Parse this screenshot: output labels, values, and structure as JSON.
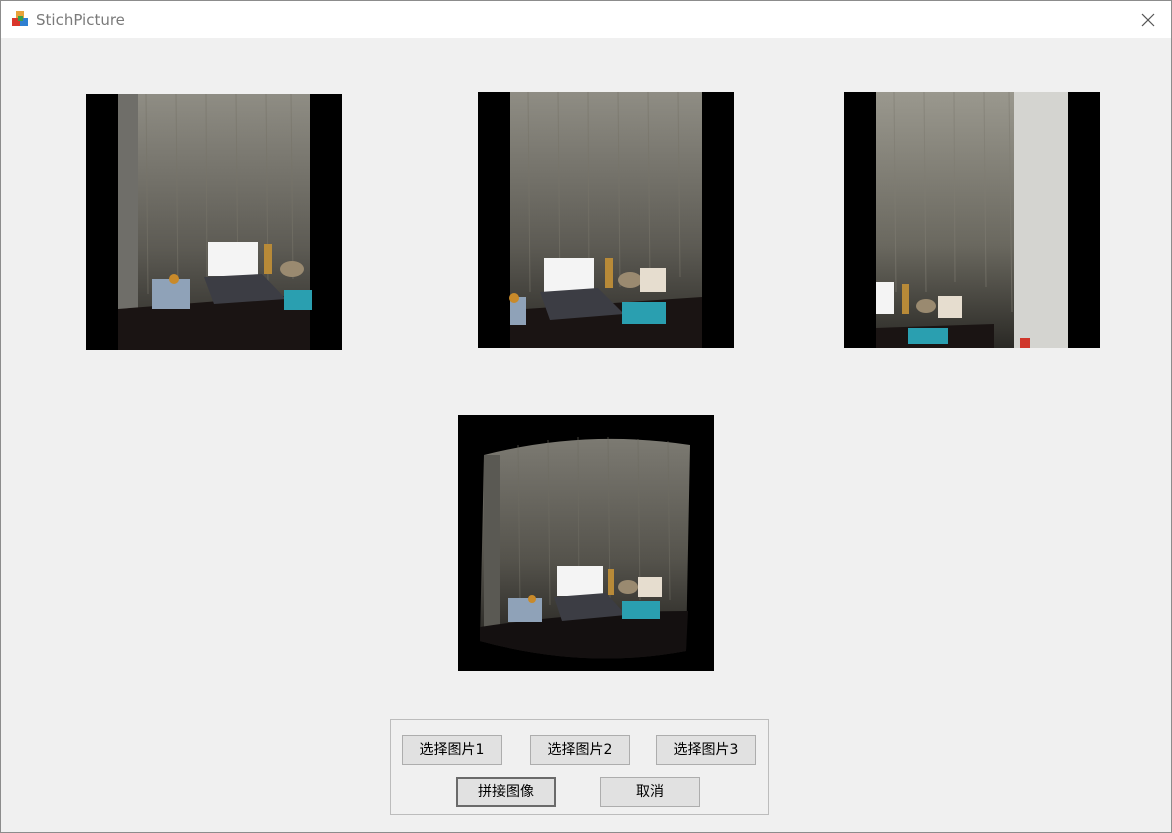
{
  "window": {
    "title": "StichPicture",
    "icon": "app-cube-icon",
    "close_icon": "close-icon"
  },
  "images": {
    "image1": {
      "name": "source-image-1",
      "content": "photo of desk with laptop and curtain"
    },
    "image2": {
      "name": "source-image-2",
      "content": "photo of desk with laptop and curtain"
    },
    "image3": {
      "name": "source-image-3",
      "content": "photo of curtain corner and wall"
    },
    "result": {
      "name": "stitched-result-image",
      "content": "panorama stitched from three photos"
    }
  },
  "buttons": {
    "select1": "选择图片1",
    "select2": "选择图片2",
    "select3": "选择图片3",
    "stitch": "拼接图像",
    "cancel": "取消"
  },
  "colors": {
    "background": "#f0f0f0",
    "titlebar": "#ffffff",
    "button_face": "#e1e1e1",
    "button_border": "#adadad"
  }
}
